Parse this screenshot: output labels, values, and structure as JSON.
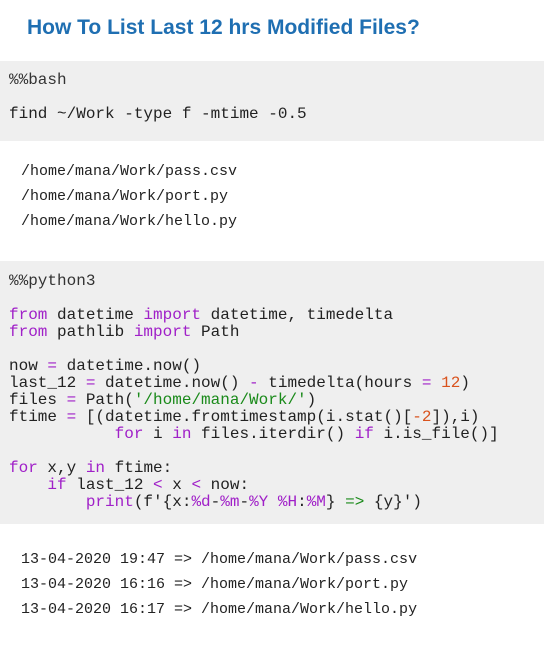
{
  "title": "How To List Last 12 hrs Modified Files?",
  "bash_cell": {
    "magic": "%%bash",
    "command": "find ~/Work -type f -mtime -0.5"
  },
  "bash_output": [
    "/home/mana/Work/pass.csv",
    "/home/mana/Work/port.py",
    "/home/mana/Work/hello.py"
  ],
  "python_cell": {
    "magic": "%%python3",
    "line1": {
      "kw1": "from",
      "mod": " datetime ",
      "kw2": "import",
      "rest": " datetime, timedelta"
    },
    "line2": {
      "kw1": "from",
      "mod": " pathlib ",
      "kw2": "import",
      "rest": " Path"
    },
    "line3": {
      "a": "now ",
      "op": "=",
      "b": " datetime.now()"
    },
    "line4": {
      "a": "last_12 ",
      "op1": "=",
      "b": " datetime.now() ",
      "op2": "-",
      "c": " timedelta(hours ",
      "op3": "=",
      "d": " ",
      "num": "12",
      "e": ")"
    },
    "line5": {
      "a": "files ",
      "op": "=",
      "b": " Path(",
      "str": "'/home/mana/Work/'",
      "c": ")"
    },
    "line6": {
      "a": "ftime ",
      "op": "=",
      "b": " [(datetime.fromtimestamp(i.stat()[",
      "neg": "-",
      "num": "2",
      "c": "]),i)"
    },
    "line7": {
      "indent": "           ",
      "kw1": "for",
      "a": " i ",
      "kw2": "in",
      "b": " files.iterdir() ",
      "kw3": "if",
      "c": " i.is_file()]"
    },
    "line8": {
      "kw1": "for",
      "a": " x,y ",
      "kw2": "in",
      "b": " ftime:"
    },
    "line9": {
      "indent": "    ",
      "kw": "if",
      "a": " last_12 ",
      "op1": "<",
      "b": " x ",
      "op2": "<",
      "c": " now:"
    },
    "line10": {
      "indent": "        ",
      "kw": "print",
      "a": "(f'",
      "b": "{x:",
      "f1": "%d",
      "d1": "-",
      "f2": "%m",
      "d2": "-",
      "f3": "%Y",
      "sp": " ",
      "f4": "%H",
      "col": ":",
      "f5": "%M",
      "c": "} ",
      "arrow": "=>",
      "d": " {y}')"
    }
  },
  "python_output": [
    "13-04-2020 19:47 => /home/mana/Work/pass.csv",
    "13-04-2020 16:16 => /home/mana/Work/port.py",
    "13-04-2020 16:17 => /home/mana/Work/hello.py"
  ]
}
